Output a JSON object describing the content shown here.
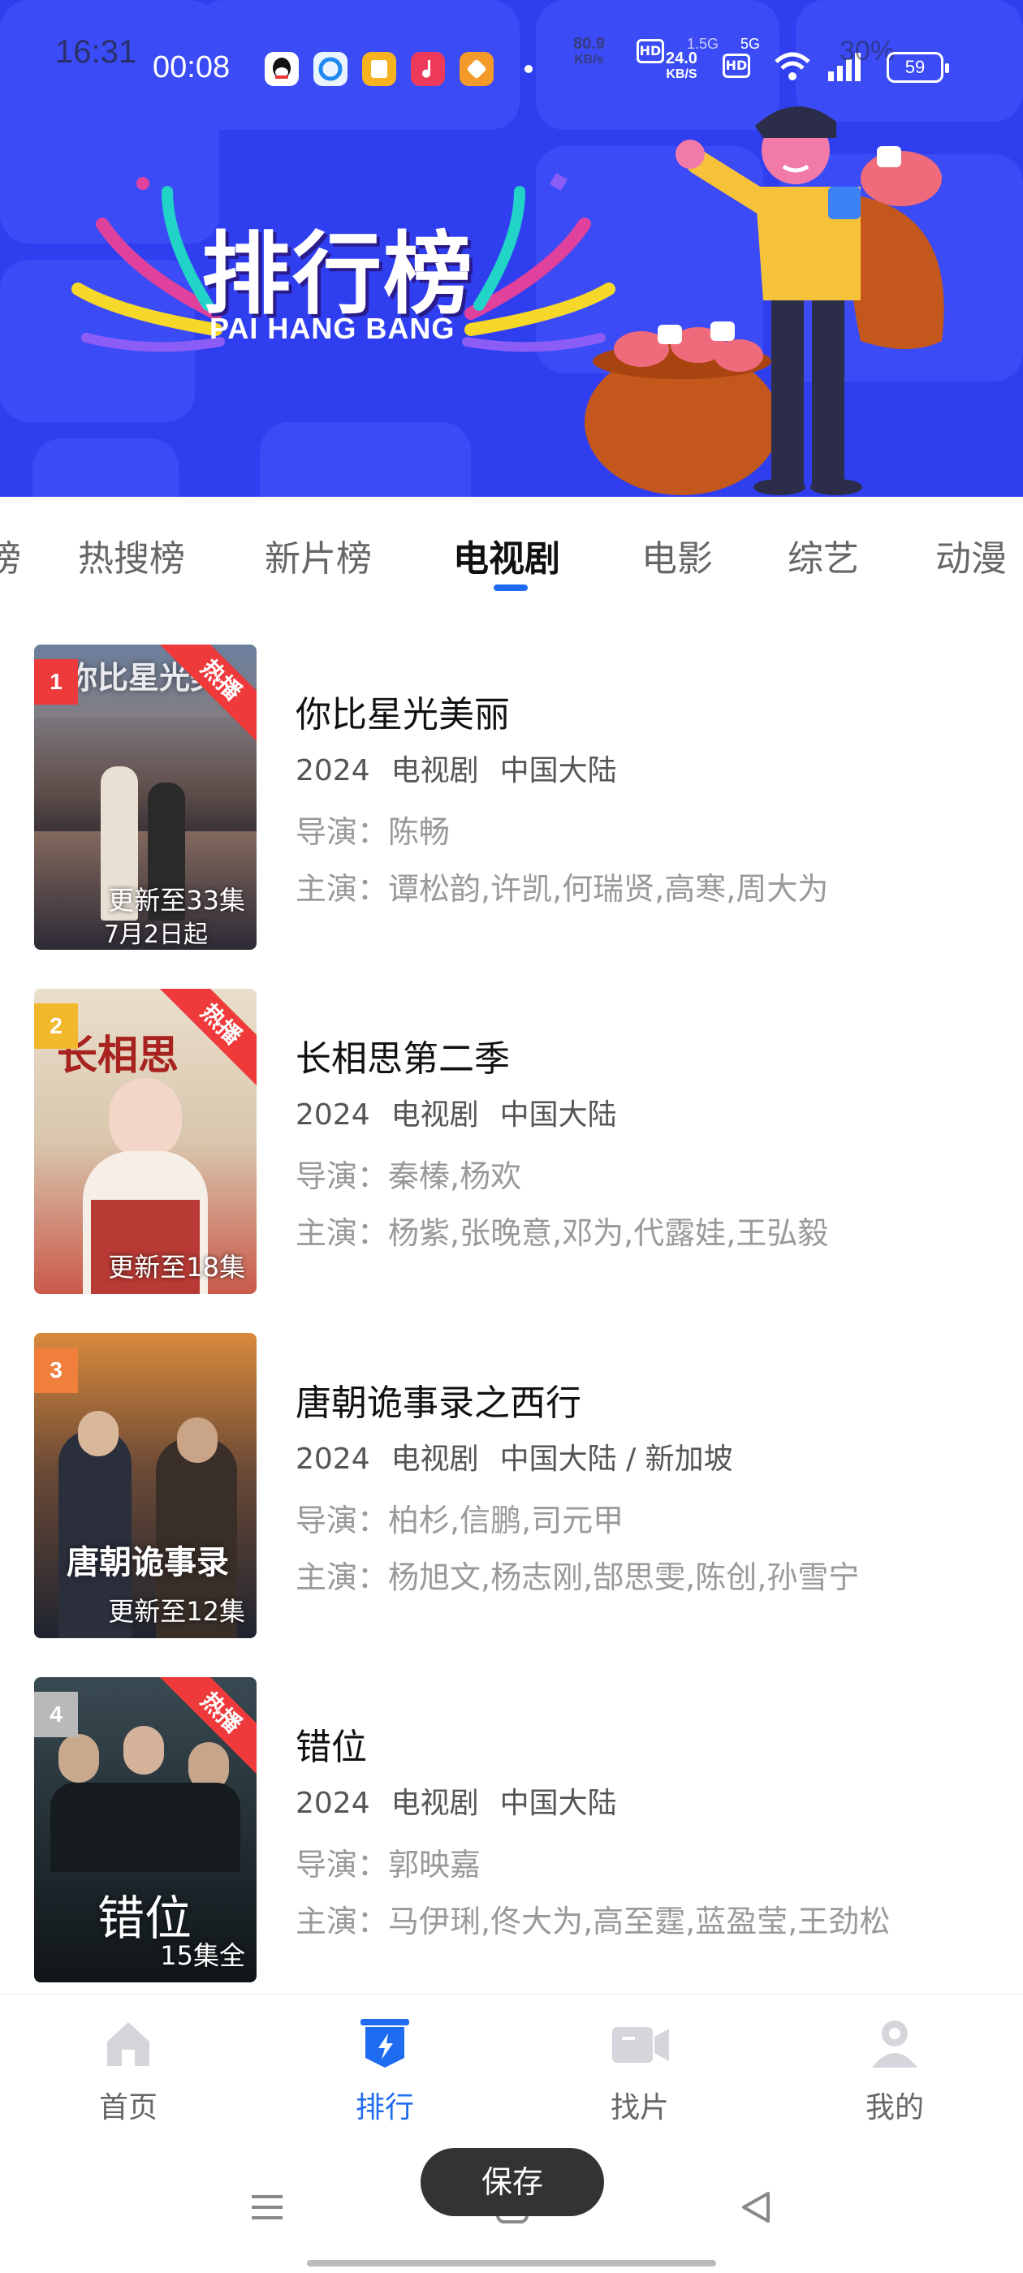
{
  "status_bar": {
    "time_left": "16:31",
    "time_main": "00:08",
    "speed_1": "80.9",
    "speed_1_unit": "KB/s",
    "speed_2": "24.0",
    "speed_2_unit": "KB/S",
    "hd": "HD",
    "net_5g": "5G",
    "net_15g": "1.5G",
    "battery": "59",
    "battery_percent_bg": "30%"
  },
  "banner": {
    "title": "排行榜",
    "subtitle": "PAI HANG BANG",
    "bg_color": "#2f3ff0"
  },
  "tabs": [
    {
      "label": "榜"
    },
    {
      "label": "热搜榜"
    },
    {
      "label": "新片榜"
    },
    {
      "label": "电视剧",
      "active": true
    },
    {
      "label": "电影"
    },
    {
      "label": "综艺"
    },
    {
      "label": "动漫"
    }
  ],
  "list": [
    {
      "rank": "1",
      "rank_color": "#ee3a3a",
      "hot_label": "热播",
      "poster_note": "更新至33集",
      "poster_extra": "7月2日起",
      "poster_art": "你比星光美",
      "title": "你比星光美丽",
      "year": "2024",
      "category": "电视剧",
      "region": "中国大陆",
      "director": "导演：陈畅",
      "cast": "主演：谭松韵,许凯,何瑞贤,高寒,周大为"
    },
    {
      "rank": "2",
      "rank_color": "#f2b82c",
      "hot_label": "热播",
      "poster_note": "更新至18集",
      "poster_art": "长相思",
      "title": "长相思第二季",
      "year": "2024",
      "category": "电视剧",
      "region": "中国大陆",
      "director": "导演：秦榛,杨欢",
      "cast": "主演：杨紫,张晚意,邓为,代露娃,王弘毅"
    },
    {
      "rank": "3",
      "rank_color": "#f07f3c",
      "poster_note": "更新至12集",
      "poster_art": "唐朝诡事录",
      "title": "唐朝诡事录之西行",
      "year": "2024",
      "category": "电视剧",
      "region": "中国大陆 / 新加坡",
      "director": "导演：柏杉,信鹏,司元甲",
      "cast": "主演：杨旭文,杨志刚,郜思雯,陈创,孙雪宁"
    },
    {
      "rank": "4",
      "rank_color": "#b9b9b9",
      "hot_label": "热播",
      "poster_note": "15集全",
      "poster_art": "错位",
      "title": "错位",
      "year": "2024",
      "category": "电视剧",
      "region": "中国大陆",
      "director": "导演：郭映嘉",
      "cast": "主演：马伊琍,佟大为,高至霆,蓝盈莹,王劲松"
    }
  ],
  "bottom_nav": [
    {
      "label": "首页",
      "icon": "home-icon"
    },
    {
      "label": "排行",
      "icon": "ranking-icon",
      "active": true
    },
    {
      "label": "找片",
      "icon": "video-camera-icon"
    },
    {
      "label": "我的",
      "icon": "profile-icon"
    }
  ],
  "toast": "保存",
  "colors": {
    "accent": "#1f6cf0",
    "hot": "#ee3a3a"
  }
}
